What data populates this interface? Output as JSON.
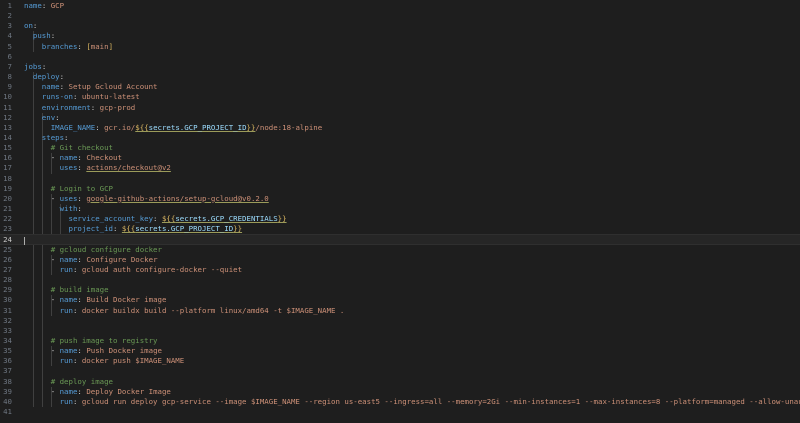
{
  "editor": {
    "language": "yaml",
    "current_line": 24
  },
  "lines": [
    {
      "n": "1",
      "segs": [
        {
          "t": "name",
          "c": "k"
        },
        {
          "t": ": ",
          "c": "p"
        },
        {
          "t": "GCP",
          "c": "s"
        }
      ]
    },
    {
      "n": "2",
      "segs": []
    },
    {
      "n": "3",
      "segs": [
        {
          "t": "on",
          "c": "k"
        },
        {
          "t": ":",
          "c": "p"
        }
      ]
    },
    {
      "n": "4",
      "segs": [
        {
          "t": "  push",
          "c": "k"
        },
        {
          "t": ":",
          "c": "p"
        }
      ]
    },
    {
      "n": "5",
      "segs": [
        {
          "t": "    branches",
          "c": "k"
        },
        {
          "t": ": ",
          "c": "p"
        },
        {
          "t": "[",
          "c": "b"
        },
        {
          "t": "main",
          "c": "s"
        },
        {
          "t": "]",
          "c": "b"
        }
      ]
    },
    {
      "n": "6",
      "segs": []
    },
    {
      "n": "7",
      "segs": [
        {
          "t": "jobs",
          "c": "k"
        },
        {
          "t": ":",
          "c": "p"
        }
      ]
    },
    {
      "n": "8",
      "segs": [
        {
          "t": "  deploy",
          "c": "k"
        },
        {
          "t": ":",
          "c": "p"
        }
      ]
    },
    {
      "n": "9",
      "segs": [
        {
          "t": "    name",
          "c": "k"
        },
        {
          "t": ": ",
          "c": "p"
        },
        {
          "t": "Setup Gcloud Account",
          "c": "s"
        }
      ]
    },
    {
      "n": "10",
      "segs": [
        {
          "t": "    runs-on",
          "c": "k"
        },
        {
          "t": ": ",
          "c": "p"
        },
        {
          "t": "ubuntu-latest",
          "c": "s"
        }
      ]
    },
    {
      "n": "11",
      "segs": [
        {
          "t": "    environment",
          "c": "k"
        },
        {
          "t": ": ",
          "c": "p"
        },
        {
          "t": "gcp-prod",
          "c": "s"
        }
      ]
    },
    {
      "n": "12",
      "segs": [
        {
          "t": "    env",
          "c": "k"
        },
        {
          "t": ":",
          "c": "p"
        }
      ]
    },
    {
      "n": "13",
      "segs": [
        {
          "t": "      IMAGE_NAME",
          "c": "k"
        },
        {
          "t": ": ",
          "c": "p"
        },
        {
          "t": "gcr.io/",
          "c": "s"
        },
        {
          "t": "${{",
          "c": "b u"
        },
        {
          "t": "secrets.GCP_PROJECT_ID",
          "c": "v"
        },
        {
          "t": "}}",
          "c": "b u"
        },
        {
          "t": "/node:18-alpine",
          "c": "s"
        }
      ]
    },
    {
      "n": "14",
      "segs": [
        {
          "t": "    steps",
          "c": "k"
        },
        {
          "t": ":",
          "c": "p"
        }
      ]
    },
    {
      "n": "15",
      "segs": [
        {
          "t": "      # Git checkout",
          "c": "c"
        }
      ]
    },
    {
      "n": "16",
      "segs": [
        {
          "t": "      - ",
          "c": "p"
        },
        {
          "t": "name",
          "c": "k"
        },
        {
          "t": ": ",
          "c": "p"
        },
        {
          "t": "Checkout",
          "c": "s"
        }
      ]
    },
    {
      "n": "17",
      "segs": [
        {
          "t": "        uses",
          "c": "k"
        },
        {
          "t": ": ",
          "c": "p"
        },
        {
          "t": "actions/checkout@v2",
          "c": "s u"
        }
      ]
    },
    {
      "n": "18",
      "segs": []
    },
    {
      "n": "19",
      "segs": [
        {
          "t": "      # Login to GCP",
          "c": "c"
        }
      ]
    },
    {
      "n": "20",
      "segs": [
        {
          "t": "      - ",
          "c": "p"
        },
        {
          "t": "uses",
          "c": "k"
        },
        {
          "t": ": ",
          "c": "p"
        },
        {
          "t": "google-github-actions/setup-gcloud@v0.2.0",
          "c": "s u"
        }
      ]
    },
    {
      "n": "21",
      "segs": [
        {
          "t": "        with",
          "c": "k"
        },
        {
          "t": ":",
          "c": "p"
        }
      ]
    },
    {
      "n": "22",
      "segs": [
        {
          "t": "          service_account_key",
          "c": "k"
        },
        {
          "t": ": ",
          "c": "p"
        },
        {
          "t": "${{",
          "c": "b u"
        },
        {
          "t": "secrets.GCP_CREDENTIALS",
          "c": "v"
        },
        {
          "t": "}}",
          "c": "b u"
        }
      ]
    },
    {
      "n": "23",
      "segs": [
        {
          "t": "          project_id",
          "c": "k"
        },
        {
          "t": ": ",
          "c": "p"
        },
        {
          "t": "${{",
          "c": "b u"
        },
        {
          "t": "secrets.GCP_PROJECT_ID",
          "c": "v"
        },
        {
          "t": "}}",
          "c": "b u"
        }
      ]
    },
    {
      "n": "24",
      "segs": []
    },
    {
      "n": "25",
      "segs": [
        {
          "t": "      # gcloud configure docker",
          "c": "c"
        }
      ]
    },
    {
      "n": "26",
      "segs": [
        {
          "t": "      - ",
          "c": "p"
        },
        {
          "t": "name",
          "c": "k"
        },
        {
          "t": ": ",
          "c": "p"
        },
        {
          "t": "Configure Docker",
          "c": "s"
        }
      ]
    },
    {
      "n": "27",
      "segs": [
        {
          "t": "        run",
          "c": "k"
        },
        {
          "t": ": ",
          "c": "p"
        },
        {
          "t": "gcloud auth configure-docker --quiet",
          "c": "s"
        }
      ]
    },
    {
      "n": "28",
      "segs": []
    },
    {
      "n": "29",
      "segs": [
        {
          "t": "      # build image",
          "c": "c"
        }
      ]
    },
    {
      "n": "30",
      "segs": [
        {
          "t": "      - ",
          "c": "p"
        },
        {
          "t": "name",
          "c": "k"
        },
        {
          "t": ": ",
          "c": "p"
        },
        {
          "t": "Build Docker image",
          "c": "s"
        }
      ]
    },
    {
      "n": "31",
      "segs": [
        {
          "t": "        run",
          "c": "k"
        },
        {
          "t": ": ",
          "c": "p"
        },
        {
          "t": "docker buildx build --platform linux/amd64 -t $IMAGE_NAME .",
          "c": "s"
        }
      ]
    },
    {
      "n": "32",
      "segs": []
    },
    {
      "n": "33",
      "segs": []
    },
    {
      "n": "34",
      "segs": [
        {
          "t": "      # push image to registry",
          "c": "c"
        }
      ]
    },
    {
      "n": "35",
      "segs": [
        {
          "t": "      - ",
          "c": "p"
        },
        {
          "t": "name",
          "c": "k"
        },
        {
          "t": ": ",
          "c": "p"
        },
        {
          "t": "Push Docker image",
          "c": "s"
        }
      ]
    },
    {
      "n": "36",
      "segs": [
        {
          "t": "        run",
          "c": "k"
        },
        {
          "t": ": ",
          "c": "p"
        },
        {
          "t": "docker push $IMAGE_NAME",
          "c": "s"
        }
      ]
    },
    {
      "n": "37",
      "segs": []
    },
    {
      "n": "38",
      "segs": [
        {
          "t": "      # deploy image",
          "c": "c"
        }
      ]
    },
    {
      "n": "39",
      "segs": [
        {
          "t": "      - ",
          "c": "p"
        },
        {
          "t": "name",
          "c": "k"
        },
        {
          "t": ": ",
          "c": "p"
        },
        {
          "t": "Deploy Docker Image",
          "c": "s"
        }
      ]
    },
    {
      "n": "40",
      "segs": [
        {
          "t": "        run",
          "c": "k"
        },
        {
          "t": ": ",
          "c": "p"
        },
        {
          "t": "gcloud run deploy gcp-service --image $IMAGE_NAME --region us-east5 --ingress=all --memory=2Gi --min-instances=1 --max-instances=8 --platform=managed --allow-unauthenticated",
          "c": "s"
        }
      ]
    },
    {
      "n": "41",
      "segs": []
    }
  ]
}
